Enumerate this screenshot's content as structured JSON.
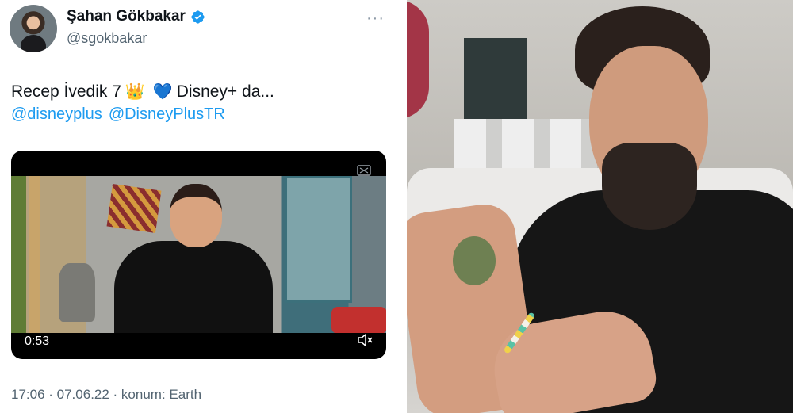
{
  "tweet": {
    "display_name": "Şahan Gökbakar",
    "handle": "@sgokbakar",
    "more_label": "···",
    "text": {
      "part1": "Recep İvedik 7",
      "crown": "👑",
      "heart": "💙",
      "part2": "Disney+ da..."
    },
    "mentions": [
      "@disneyplus",
      "@DisneyPlusTR"
    ],
    "video": {
      "duration": "0:53"
    },
    "timestamp": "17:06 · 07.06.22 · konum: Earth"
  },
  "colors": {
    "link": "#1d9bf0",
    "verified": "#1d9bf0",
    "secondary_text": "#536471"
  },
  "icons": {
    "verified": "verified-badge-icon",
    "more": "more-dots-icon",
    "mute": "mute-speaker-icon",
    "pip": "picture-in-picture-icon"
  }
}
